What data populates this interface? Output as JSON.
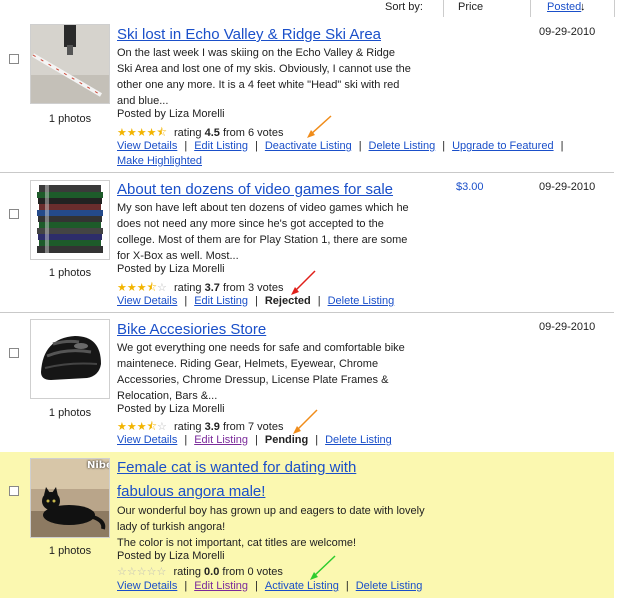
{
  "sort": {
    "label": "Sort by:",
    "price": "Price",
    "posted": "Posted",
    "arrow": "↓"
  },
  "listings": [
    {
      "title": "Ski lost in Echo Valley & Ridge Ski Area",
      "desc": "On the last week I was skiing on the Echo Valley & Ridge Ski Area and lost one of my skis. Obviously, I cannot use the other one any more. It is a 4 feet white \"Head\" ski with red and blue...",
      "photos": "1 photos",
      "posted_by": "Posted by Liza Morelli",
      "rating_value": "4.5",
      "rating_votes": "6 votes",
      "stars": 4.5,
      "price": "",
      "date": "09-29-2010",
      "actions": [
        "View Details",
        "Edit Listing",
        "Deactivate Listing",
        "Delete Listing",
        "Upgrade to Featured",
        "Make Highlighted"
      ]
    },
    {
      "title": "About ten dozens of video games for sale",
      "desc": "My son have left about ten dozens of video games which he does not need any more since he's got accepted to the college. Most of them are for Play Station 1, there are some for X-Box as well. Most...",
      "photos": "1 photos",
      "posted_by": "Posted by Liza Morelli",
      "rating_value": "3.7",
      "rating_votes": "3 votes",
      "stars": 3.5,
      "price": "$3.00",
      "date": "09-29-2010",
      "actions": [
        "View Details",
        "Edit Listing",
        "Delete Listing"
      ],
      "status": "Rejected"
    },
    {
      "title": "Bike Accesiories Store",
      "desc": "We got everything one needs for safe and comfortable bike maintenece. Riding Gear, Helmets, Eyewear, Chrome Accessories, Chrome Dressup, License Plate Frames & Relocation, Bars &...",
      "photos": "1 photos",
      "posted_by": "Posted by Liza Morelli",
      "rating_value": "3.9",
      "rating_votes": "7 votes",
      "stars": 3.5,
      "price": "",
      "date": "09-29-2010",
      "actions": [
        "View Details",
        "Edit Listing",
        "Delete Listing"
      ],
      "status": "Pending"
    },
    {
      "title_line1": "Female cat is wanted for dating with",
      "title_line2": "fabulous angora male!",
      "desc_line1": "Our wonderful boy has grown up and eagers to date with lovely",
      "desc_line2": "lady of turkish angora!",
      "desc_line3": "The color is not important, cat titles are welcome!",
      "photos": "1 photos",
      "posted_by": "Posted by Liza Morelli",
      "rating_value": "0.0",
      "rating_votes": "0 votes",
      "stars": 0,
      "date": "",
      "thumb_text": "Nibelu",
      "actions": [
        "View Details",
        "Edit Listing",
        "Activate Listing",
        "Delete Listing"
      ]
    }
  ],
  "labels": {
    "rating": "rating",
    "from": "from",
    "sep": "|"
  },
  "colors": {
    "link": "#1a4fc9",
    "visited": "#7a2a9a",
    "featured_bg": "#fbf8b0",
    "arrow_orange": "#f08c1a",
    "arrow_red": "#e0201a",
    "arrow_green": "#2ecc2e"
  }
}
